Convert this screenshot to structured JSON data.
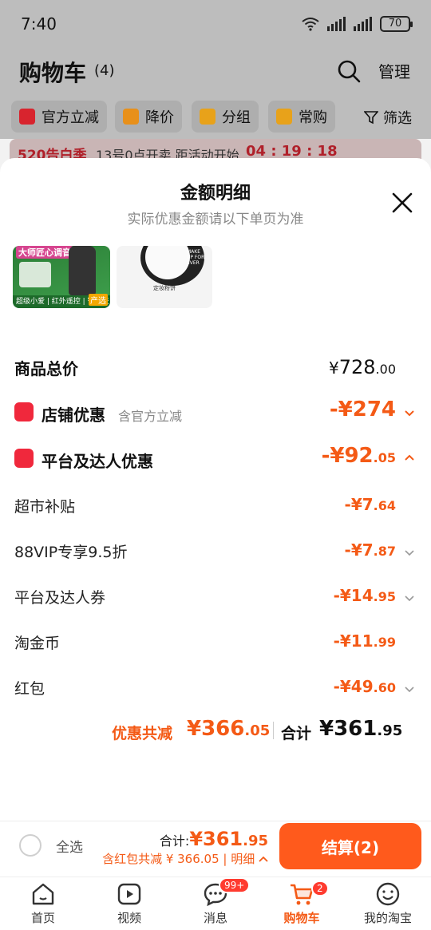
{
  "status": {
    "time": "7:40",
    "battery": "70"
  },
  "header": {
    "title": "购物车",
    "count": "(4)",
    "manage": "管理"
  },
  "filters": [
    {
      "label": "官方立减",
      "color": "#d8242e"
    },
    {
      "label": "降价",
      "color": "#e8901a"
    },
    {
      "label": "分组",
      "color": "#e8a21a"
    },
    {
      "label": "常购",
      "color": "#e8a21a"
    }
  ],
  "filter_btn": "筛选",
  "promo": {
    "tag": "520告白季",
    "text": "13号0点开卖,距活动开始",
    "timer": "04 : 19 : 18"
  },
  "sheet": {
    "title": "金额明细",
    "subtitle": "实际优惠金额请以下单页为准",
    "products": [
      {
        "badge": "大师匠心调音",
        "tag": "产选",
        "footer": "超级小爱 | 红外遥控 | 智能交互"
      },
      {
        "brand": "MAKE UP FOR EVER",
        "caption": "定妆粉饼"
      }
    ],
    "total": {
      "label": "商品总价",
      "currency": "¥",
      "int": "728",
      "dec": ".00"
    },
    "store": {
      "label": "店铺优惠",
      "sub": "含官方立减",
      "value": "-¥274"
    },
    "platform": {
      "label": "平台及达人优惠",
      "int": "-¥92",
      "dec": ".05"
    },
    "items": [
      {
        "label": "超市补贴",
        "int": "-¥7",
        "dec": ".64",
        "expandable": false
      },
      {
        "label": "88VIP专享9.5折",
        "int": "-¥7",
        "dec": ".87",
        "expandable": true
      },
      {
        "label": "平台及达人券",
        "int": "-¥14",
        "dec": ".95",
        "expandable": true
      },
      {
        "label": "淘金币",
        "int": "-¥11",
        "dec": ".99",
        "expandable": false
      },
      {
        "label": "红包",
        "int": "-¥49",
        "dec": ".60",
        "expandable": true
      }
    ],
    "summary": {
      "discount_label": "优惠共减",
      "discount_int": "¥366",
      "discount_dec": ".05",
      "total_label": "合计",
      "total_int": "¥361",
      "total_dec": ".95"
    }
  },
  "bottom": {
    "select_all": "全选",
    "total_label": "合计:",
    "total_int": "¥361",
    "total_dec": ".95",
    "discount_text": "含红包共减 ¥ 366.05 | 明细",
    "checkout": "结算(2)"
  },
  "tabs": [
    {
      "label": "首页",
      "icon": "home-icon"
    },
    {
      "label": "视频",
      "icon": "video-icon"
    },
    {
      "label": "消息",
      "icon": "message-icon",
      "badge": "99+"
    },
    {
      "label": "购物车",
      "icon": "cart-icon",
      "badge": "2",
      "active": true
    },
    {
      "label": "我的淘宝",
      "icon": "profile-icon"
    }
  ],
  "colors": {
    "accent": "#f45a16",
    "checkout": "#ff5a1c",
    "red": "#f0283c"
  }
}
